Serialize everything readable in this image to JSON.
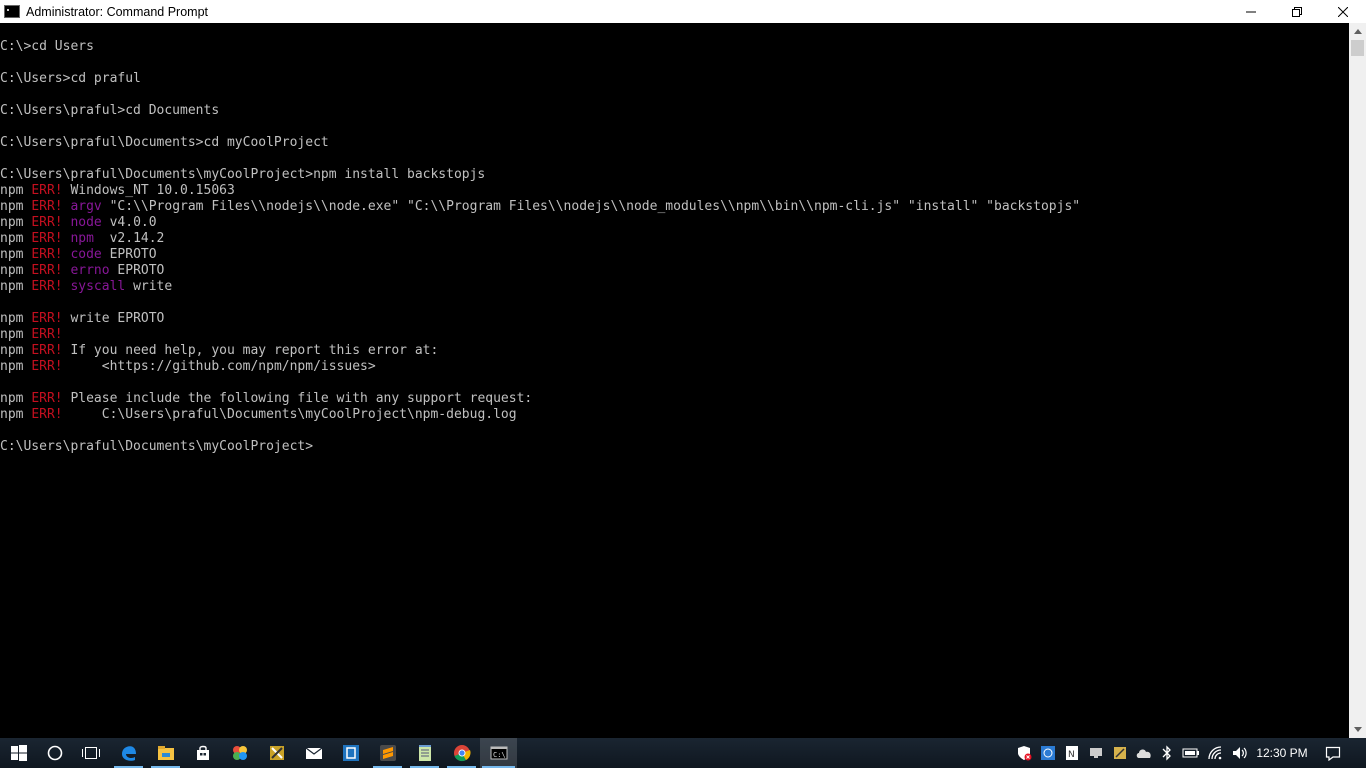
{
  "window": {
    "title": "Administrator: Command Prompt"
  },
  "console": {
    "prompt_user": "C:\\Users\\praful\\Documents\\myCoolProject>",
    "lines": [
      {
        "type": "cmd",
        "text": "C:\\>cd Users"
      },
      {
        "type": "cmd",
        "text": "C:\\Users>cd praful"
      },
      {
        "type": "cmd",
        "text": "C:\\Users\\praful>cd Documents"
      },
      {
        "type": "cmd",
        "text": "C:\\Users\\praful\\Documents>cd myCoolProject"
      },
      {
        "type": "cmd",
        "text": "C:\\Users\\praful\\Documents\\myCoolProject>npm install backstopjs"
      },
      {
        "type": "err",
        "key": "",
        "text": "Windows_NT 10.0.15063"
      },
      {
        "type": "err",
        "key": "argv",
        "text": " \"C:\\\\Program Files\\\\nodejs\\\\node.exe\" \"C:\\\\Program Files\\\\nodejs\\\\node_modules\\\\npm\\\\bin\\\\npm-cli.js\" \"install\" \"backstopjs\""
      },
      {
        "type": "err",
        "key": "node",
        "text": " v4.0.0"
      },
      {
        "type": "err",
        "key": "npm ",
        "text": " v2.14.2"
      },
      {
        "type": "err",
        "key": "code",
        "text": " EPROTO"
      },
      {
        "type": "err",
        "key": "errno",
        "text": " EPROTO"
      },
      {
        "type": "err",
        "key": "syscall",
        "text": " write"
      },
      {
        "type": "err",
        "key": "",
        "text": "write EPROTO"
      },
      {
        "type": "err",
        "key": "",
        "text": ""
      },
      {
        "type": "err",
        "key": "",
        "text": "If you need help, you may report this error at:"
      },
      {
        "type": "err",
        "key": "",
        "text": "    <https://github.com/npm/npm/issues>"
      },
      {
        "type": "err",
        "key": "",
        "text": "Please include the following file with any support request:"
      },
      {
        "type": "err",
        "key": "",
        "text": "    C:\\Users\\praful\\Documents\\myCoolProject\\npm-debug.log"
      },
      {
        "type": "cmd",
        "text": "C:\\Users\\praful\\Documents\\myCoolProject>"
      }
    ],
    "npm_label": "npm",
    "err_label": "ERR!"
  },
  "taskbar": {
    "clock": "12:30 PM",
    "apps": [
      {
        "name": "start",
        "icon": "windows-logo-icon"
      },
      {
        "name": "search",
        "icon": "search-circle-icon"
      },
      {
        "name": "task-view",
        "icon": "task-view-icon"
      },
      {
        "name": "edge",
        "icon": "edge-icon"
      },
      {
        "name": "file-explorer",
        "icon": "folder-icon"
      },
      {
        "name": "store",
        "icon": "store-bag-icon"
      },
      {
        "name": "app-6",
        "icon": "puzzle-icon"
      },
      {
        "name": "app-7",
        "icon": "tools-icon"
      },
      {
        "name": "mail",
        "icon": "mail-icon"
      },
      {
        "name": "app-9",
        "icon": "bracket-icon"
      },
      {
        "name": "sublime",
        "icon": "sublime-icon"
      },
      {
        "name": "notepad",
        "icon": "notepad-icon"
      },
      {
        "name": "chrome",
        "icon": "chrome-icon"
      },
      {
        "name": "cmd",
        "icon": "cmd-icon"
      }
    ]
  },
  "colors": {
    "console_bg": "#000000",
    "console_text": "#c0c0c0",
    "err_red": "#c50f1f",
    "key_purple": "#881798",
    "taskbar_accent": "#76b9ed"
  }
}
